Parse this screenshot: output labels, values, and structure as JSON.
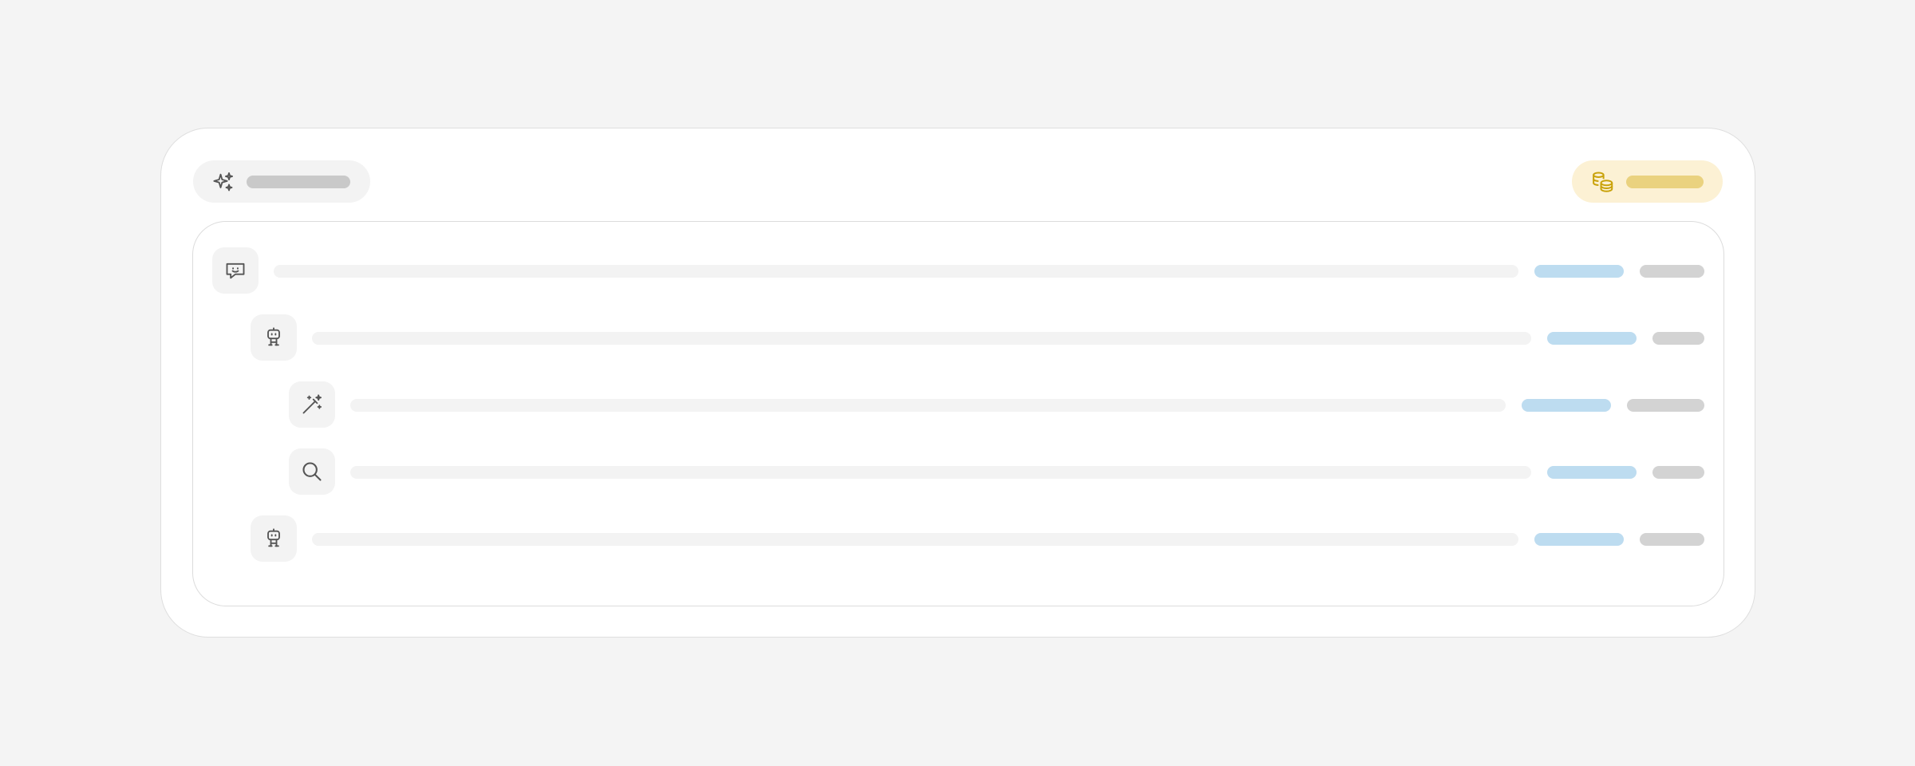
{
  "header": {
    "left_badge": {
      "icon": "sparkles-icon",
      "label": ""
    },
    "right_badge": {
      "icon": "coins-icon",
      "label": "",
      "accent": "#c9a20a"
    }
  },
  "colors": {
    "page_bg": "#f4f4f4",
    "card_bg": "#ffffff",
    "skeleton_text": "#f3f3f3",
    "skeleton_tag": "#bddcf0",
    "skeleton_meta": "#d3d3d3"
  },
  "rows": [
    {
      "icon": "chat-bubble-icon",
      "depth": 0,
      "text": "",
      "tag": "",
      "meta": ""
    },
    {
      "icon": "robot-icon",
      "depth": 1,
      "text": "",
      "tag": "",
      "meta": ""
    },
    {
      "icon": "magic-wand-icon",
      "depth": 2,
      "text": "",
      "tag": "",
      "meta": ""
    },
    {
      "icon": "search-icon",
      "depth": 2,
      "text": "",
      "tag": "",
      "meta": ""
    },
    {
      "icon": "robot-icon",
      "depth": 1,
      "text": "",
      "tag": "",
      "meta": ""
    }
  ]
}
